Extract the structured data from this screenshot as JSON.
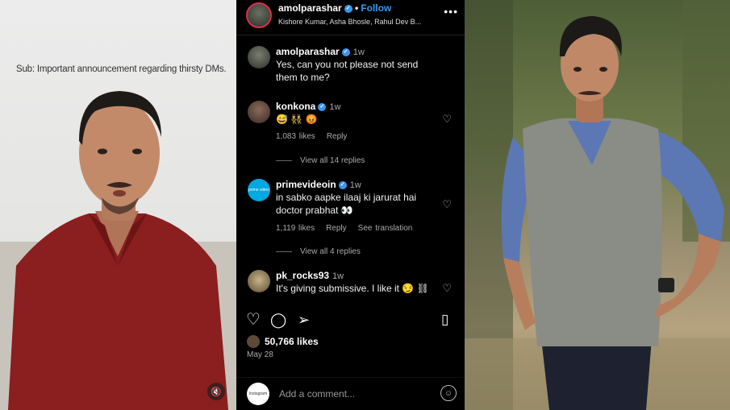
{
  "left_panel": {
    "caption": "Sub: Important announcement regarding thirsty DMs.",
    "mute_icon": "speaker-muted-icon"
  },
  "post": {
    "username": "amolparashar",
    "follow_label": "Follow",
    "audio": "Kishore Kumar, Asha Bhosle, Rahul Dev B...",
    "more_icon": "more-horizontal-icon",
    "likes": "50,766 likes",
    "date": "May 28",
    "add_comment_placeholder": "Add a comment...",
    "self_avatar_label": "Instagram"
  },
  "comments": [
    {
      "user": "amolparashar",
      "verified": true,
      "time": "1w",
      "text": "Yes, can you not please not send them to me?"
    },
    {
      "user": "konkona",
      "verified": true,
      "time": "1w",
      "text": "😅 👯 😡",
      "likes": "1,083 likes",
      "reply": "Reply",
      "view_replies": "View all 14 replies"
    },
    {
      "user": "primevideoin",
      "verified": true,
      "time": "1w",
      "text": "in sabko aapke ilaaj ki jarurat hai doctor prabhat 👀",
      "likes": "1,119 likes",
      "reply": "Reply",
      "see_translation": "See translation",
      "view_replies": "View all 4 replies",
      "avatar_label": "prime video"
    },
    {
      "user": "pk_rocks93",
      "verified": false,
      "time": "1w",
      "text": "It's giving submissive. I like it 😏 ⛓"
    }
  ],
  "colors": {
    "instagram_blue": "#3897f0",
    "story_ring": "#d9304a",
    "prime_blue": "#00a8e1"
  }
}
